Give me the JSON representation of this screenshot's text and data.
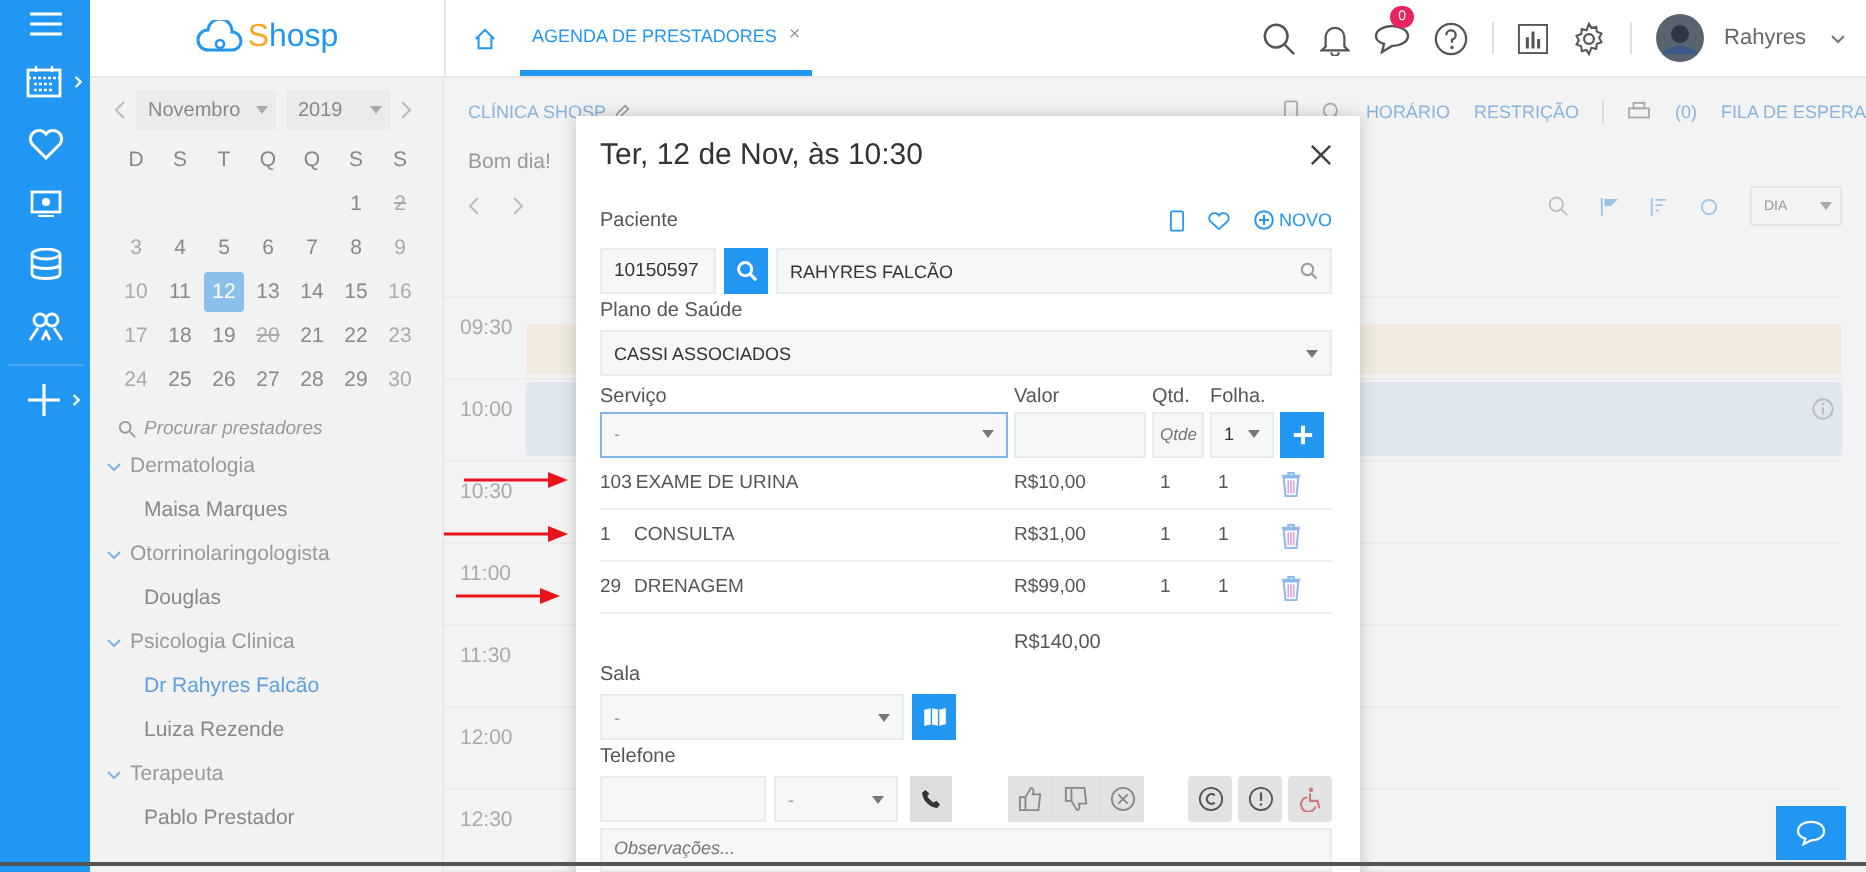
{
  "header": {
    "logo": "Shosp",
    "tabs": [
      {
        "label": "AGENDA DE PRESTADORES",
        "selected": true,
        "close": "×"
      }
    ],
    "chat_badge": "0",
    "user": "Rahyres"
  },
  "calendar": {
    "month": "Novembro",
    "year": "2019",
    "weekdays": [
      "D",
      "S",
      "T",
      "Q",
      "Q",
      "S",
      "S"
    ],
    "weeks": [
      [
        {
          "kind": "blank"
        },
        {
          "kind": "blank"
        },
        {
          "kind": "blank"
        },
        {
          "kind": "blank"
        },
        {
          "kind": "blank"
        },
        {
          "kind": "weekday",
          "day": "1",
          "selected": false
        },
        {
          "kind": "holiday",
          "day": "2",
          "selected": false
        }
      ],
      [
        {
          "kind": "weekend",
          "day": "3",
          "selected": false
        },
        {
          "kind": "weekday",
          "day": "4",
          "selected": false
        },
        {
          "kind": "weekday",
          "day": "5",
          "selected": false
        },
        {
          "kind": "weekday",
          "day": "6",
          "selected": false
        },
        {
          "kind": "weekday",
          "day": "7",
          "selected": false
        },
        {
          "kind": "weekday",
          "day": "8",
          "selected": false
        },
        {
          "kind": "weekend",
          "day": "9",
          "selected": false
        }
      ],
      [
        {
          "kind": "weekend",
          "day": "10",
          "selected": false
        },
        {
          "kind": "weekday",
          "day": "11",
          "selected": false
        },
        {
          "kind": "weekday",
          "day": "12",
          "selected": true
        },
        {
          "kind": "weekday",
          "day": "13",
          "selected": false
        },
        {
          "kind": "weekday",
          "day": "14",
          "selected": false
        },
        {
          "kind": "weekday",
          "day": "15",
          "selected": false
        },
        {
          "kind": "weekend",
          "day": "16",
          "selected": false
        }
      ],
      [
        {
          "kind": "weekend",
          "day": "17",
          "selected": false
        },
        {
          "kind": "weekday",
          "day": "18",
          "selected": false
        },
        {
          "kind": "weekday",
          "day": "19",
          "selected": false
        },
        {
          "kind": "holiday",
          "day": "20",
          "selected": false
        },
        {
          "kind": "weekday",
          "day": "21",
          "selected": false
        },
        {
          "kind": "weekday",
          "day": "22",
          "selected": false
        },
        {
          "kind": "weekend",
          "day": "23",
          "selected": false
        }
      ],
      [
        {
          "kind": "weekend",
          "day": "24",
          "selected": false
        },
        {
          "kind": "weekday",
          "day": "25",
          "selected": false
        },
        {
          "kind": "weekday",
          "day": "26",
          "selected": false
        },
        {
          "kind": "weekday",
          "day": "27",
          "selected": false
        },
        {
          "kind": "weekday",
          "day": "28",
          "selected": false
        },
        {
          "kind": "weekday",
          "day": "29",
          "selected": false
        },
        {
          "kind": "weekend",
          "day": "30",
          "selected": false
        }
      ]
    ]
  },
  "providers": {
    "search_placeholder": "Procurar prestadores",
    "groups": [
      {
        "label": "Dermatologia",
        "expanded": true,
        "children": [
          {
            "label": "Maisa Marques",
            "selected": false
          }
        ]
      },
      {
        "label": "Otorrinolaringologista",
        "expanded": true,
        "children": [
          {
            "label": "Douglas",
            "selected": false
          }
        ]
      },
      {
        "label": "Psicologia Clinica",
        "expanded": true,
        "children": [
          {
            "label": "Dr Rahyres Falcão",
            "selected": true
          },
          {
            "label": "Luiza Rezende",
            "selected": false
          }
        ]
      },
      {
        "label": "Terapeuta",
        "expanded": true,
        "children": [
          {
            "label": "Pablo Prestador",
            "selected": false
          }
        ]
      }
    ]
  },
  "agenda": {
    "clinic": "CLÍNICA SHOSP",
    "actions": [
      "HORÁRIO",
      "RESTRIÇÃO",
      "(0)",
      "FILA DE ESPERA"
    ],
    "greeting": "Bom dia!",
    "view": "DIA",
    "slots": [
      {
        "time": "09:30",
        "event": {
          "color": "#f1ebdf"
        }
      },
      {
        "time": "10:00",
        "event": {
          "color": "#dfe7f0"
        }
      },
      {
        "time": "10:30"
      },
      {
        "time": "11:00"
      },
      {
        "time": "11:30"
      },
      {
        "time": "12:00"
      },
      {
        "time": "12:30"
      }
    ]
  },
  "modal": {
    "title": "Ter, 12 de Nov, às 10:30",
    "patient_label": "Paciente",
    "new_label": "NOVO",
    "patient_code": "10150597",
    "patient_name": "RAHYRES FALCÃO",
    "plan_label": "Plano de Saúde",
    "plan": "CASSI ASSOCIADOS",
    "service_columns": [
      "Serviço",
      "Valor",
      "Qtd.",
      "Folha."
    ],
    "service_select": "-",
    "qty_placeholder": "Qtde",
    "sheet_select": "1",
    "services": [
      {
        "code": "103",
        "name": "EXAME DE URINA",
        "value": "R$10,00",
        "qty": "1",
        "sheet": "1"
      },
      {
        "code": "1",
        "name": "CONSULTA",
        "value": "R$31,00",
        "qty": "1",
        "sheet": "1"
      },
      {
        "code": "29",
        "name": "DRENAGEM",
        "value": "R$99,00",
        "qty": "1",
        "sheet": "1"
      }
    ],
    "total": "R$140,00",
    "room_label": "Sala",
    "room_select": "-",
    "phone_label": "Telefone",
    "phone_select": "-",
    "notes_placeholder": "Observações..."
  }
}
